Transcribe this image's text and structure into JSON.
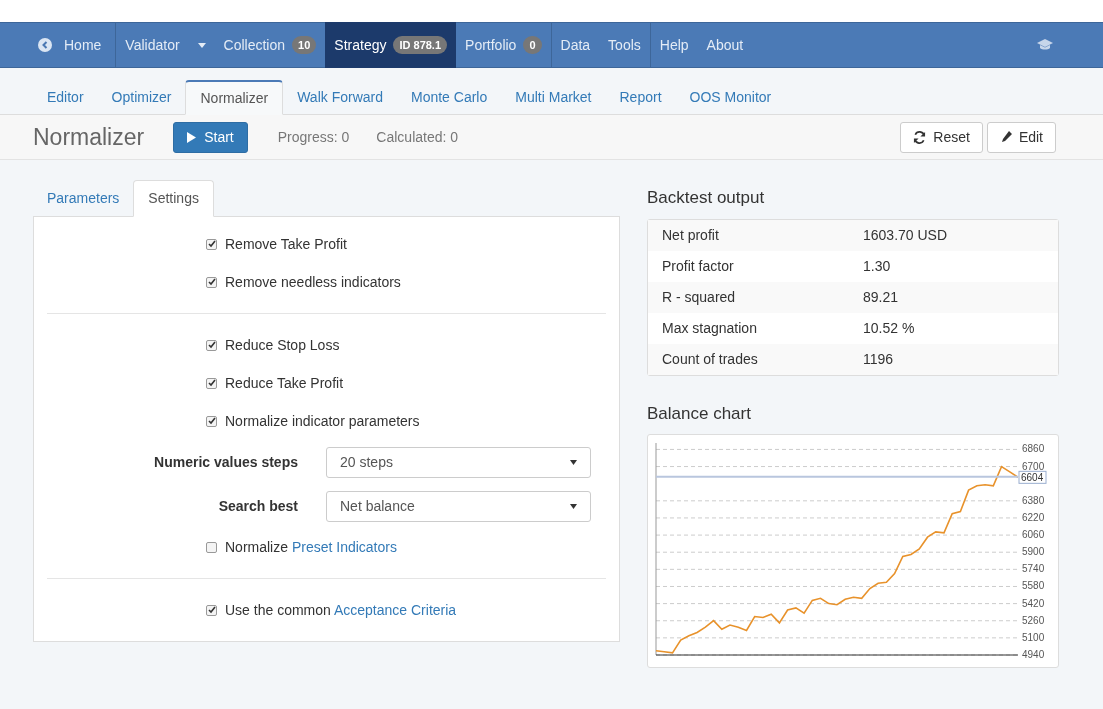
{
  "navbar": {
    "items": [
      {
        "kind": "home",
        "label": "Home",
        "selected": false
      },
      {
        "kind": "dropdown",
        "label": "Validator",
        "selected": false
      },
      {
        "kind": "badge",
        "label": "Collection",
        "badge": "10",
        "selected": false
      },
      {
        "kind": "badge",
        "label": "Strategy",
        "badge": "ID 878.1",
        "selected": true
      },
      {
        "kind": "badge",
        "label": "Portfolio",
        "badge": "0",
        "selected": false
      },
      {
        "kind": "plain",
        "label": "Data",
        "selected": false
      },
      {
        "kind": "plain",
        "label": "Tools",
        "selected": false
      },
      {
        "kind": "plain",
        "label": "Help",
        "selected": false
      },
      {
        "kind": "plain",
        "label": "About",
        "selected": false
      }
    ]
  },
  "tool_tabs": [
    {
      "label": "Editor",
      "selected": false
    },
    {
      "label": "Optimizer",
      "selected": false
    },
    {
      "label": "Normalizer",
      "selected": true
    },
    {
      "label": "Walk Forward",
      "selected": false
    },
    {
      "label": "Monte Carlo",
      "selected": false
    },
    {
      "label": "Multi Market",
      "selected": false
    },
    {
      "label": "Report",
      "selected": false
    },
    {
      "label": "OOS Monitor",
      "selected": false
    }
  ],
  "header": {
    "title": "Normalizer",
    "start_button": "Start",
    "progress": "Progress: 0",
    "calculated": "Calculated: 0",
    "reset_button": "Reset",
    "edit_button": "Edit"
  },
  "panel_tabs": [
    {
      "label": "Parameters",
      "selected": false
    },
    {
      "label": "Settings",
      "selected": true
    }
  ],
  "settings": {
    "groups": [
      [
        {
          "kind": "checkbox",
          "label": "Remove Take Profit",
          "checked": true
        },
        {
          "kind": "checkbox",
          "label": "Remove needless indicators",
          "checked": true
        }
      ],
      [
        {
          "kind": "checkbox",
          "label": "Reduce Stop Loss",
          "checked": true
        },
        {
          "kind": "checkbox",
          "label": "Reduce Take Profit",
          "checked": true
        },
        {
          "kind": "checkbox",
          "label": "Normalize indicator parameters",
          "checked": true
        },
        {
          "kind": "select",
          "label": "Numeric values steps",
          "value": "20 steps"
        },
        {
          "kind": "select",
          "label": "Search best",
          "value": "Net balance"
        },
        {
          "kind": "checkbox",
          "label": "Normalize",
          "link": "Preset Indicators",
          "checked": false
        }
      ],
      [
        {
          "kind": "checkbox",
          "label": "Use the common",
          "link": "Acceptance Criteria",
          "checked": true
        }
      ]
    ]
  },
  "backtest_output": {
    "title": "Backtest output",
    "rows": [
      {
        "label": "Net profit",
        "value": "1603.70 USD"
      },
      {
        "label": "Profit factor",
        "value": "1.30"
      },
      {
        "label": "R - squared",
        "value": "89.21"
      },
      {
        "label": "Max stagnation",
        "value": "10.52 %"
      },
      {
        "label": "Count of trades",
        "value": "1196"
      }
    ]
  },
  "balance_chart": {
    "title": "Balance chart",
    "chart_data": {
      "type": "line",
      "ylim": [
        4940,
        6920
      ],
      "yticks": [
        4940,
        5100,
        5260,
        5420,
        5580,
        5740,
        5900,
        6060,
        6220,
        6380,
        6700,
        6860
      ],
      "grid": true,
      "series": [
        {
          "color": "#e8922b",
          "values": [
            4980,
            4970,
            4960,
            5080,
            5120,
            5150,
            5200,
            5260,
            5180,
            5220,
            5200,
            5170,
            5300,
            5290,
            5320,
            5240,
            5360,
            5380,
            5330,
            5450,
            5470,
            5420,
            5410,
            5460,
            5480,
            5470,
            5560,
            5610,
            5620,
            5700,
            5860,
            5880,
            5930,
            6040,
            6090,
            6080,
            6260,
            6280,
            6480,
            6520,
            6530,
            6520,
            6700,
            6650,
            6600
          ]
        }
      ],
      "ref_lines": [
        {
          "axis": "y",
          "value": 6604,
          "label": "6604"
        }
      ]
    }
  }
}
